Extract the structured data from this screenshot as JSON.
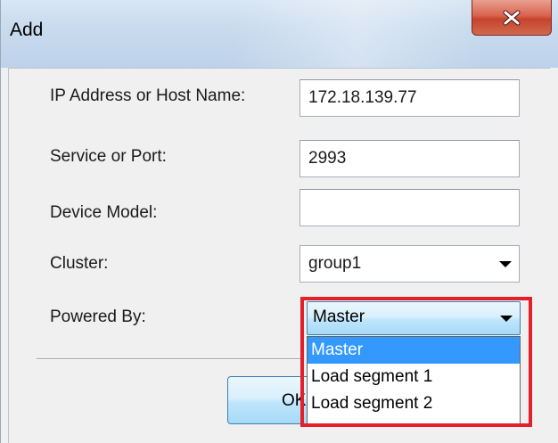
{
  "dialog": {
    "title": "Add",
    "close_icon": "close-x-icon"
  },
  "form": {
    "ip_label": "IP Address or Host Name:",
    "ip_value": "172.18.139.77",
    "port_label": "Service or Port:",
    "port_value": "2993",
    "model_label": "Device Model:",
    "model_value": "",
    "cluster_label": "Cluster:",
    "cluster_value": "group1",
    "powered_label": "Powered By:",
    "powered_value": "Master"
  },
  "dropdown": {
    "options": [
      "Master",
      "Load segment 1",
      "Load segment 2"
    ],
    "selected_index": 0
  },
  "buttons": {
    "ok_label": "OK"
  },
  "colors": {
    "highlight": "#e4202b",
    "selection": "#3399ff",
    "close_button": "#c7432c"
  }
}
